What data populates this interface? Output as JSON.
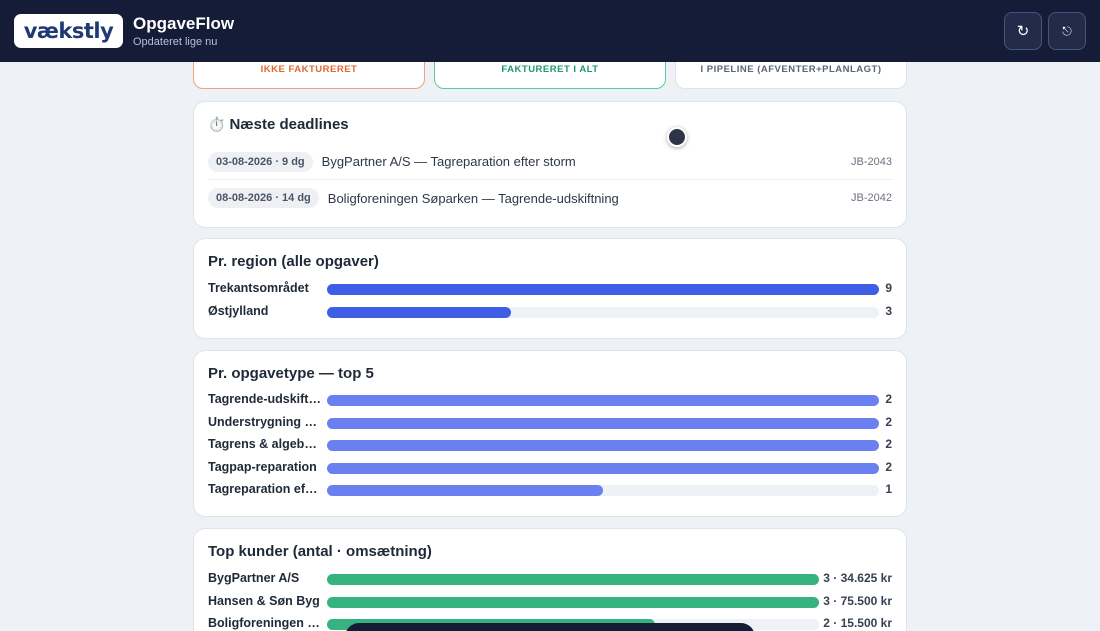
{
  "header": {
    "logo_text": "vækstly",
    "title": "OpgaveFlow",
    "subtitle": "Opdateret lige nu",
    "refresh_icon": "↻",
    "logout_icon": "⎋"
  },
  "tiles": [
    {
      "label": "IKKE FAKTURERET"
    },
    {
      "label": "FAKTURERET I ALT"
    },
    {
      "label": "I PIPELINE (AFVENTER+PLANLAGT)"
    }
  ],
  "deadlines": {
    "icon": "⏱️",
    "title": "Næste deadlines",
    "items": [
      {
        "date": "03-08-2026 · 9 dg",
        "text": "BygPartner A/S — Tagreparation efter storm",
        "id": "JB-2043"
      },
      {
        "date": "08-08-2026 · 14 dg",
        "text": "Boligforeningen Søparken — Tagrende-udskiftning",
        "id": "JB-2042"
      }
    ]
  },
  "region": {
    "title": "Pr. region (alle opgaver)",
    "color": "#3f5ee6",
    "max": 9,
    "items": [
      {
        "label": "Trekantsområdet",
        "value": 9,
        "display": "9"
      },
      {
        "label": "Østjylland",
        "value": 3,
        "display": "3"
      }
    ]
  },
  "tasktype": {
    "title": "Pr. opgavetype — top 5",
    "color": "#6a7ff0",
    "max": 2,
    "items": [
      {
        "label": "Tagrende-udskiftn…",
        "value": 2,
        "display": "2"
      },
      {
        "label": "Understrygning af …",
        "value": 2,
        "display": "2"
      },
      {
        "label": "Tagrens & algebeh…",
        "value": 2,
        "display": "2"
      },
      {
        "label": "Tagpap-reparation",
        "value": 2,
        "display": "2"
      },
      {
        "label": "Tagreparation efte…",
        "value": 1,
        "display": "1"
      }
    ]
  },
  "customers": {
    "title": "Top kunder (antal · omsætning)",
    "color": "#36b37e",
    "max": 3,
    "items": [
      {
        "label": "BygPartner A/S",
        "value": 3,
        "display": "3 · 34.625 kr"
      },
      {
        "label": "Hansen & Søn Byg",
        "value": 3,
        "display": "3 · 75.500 kr"
      },
      {
        "label": "Boligforeningen Sø…",
        "value": 2,
        "display": "2 · 15.500 kr"
      }
    ]
  }
}
